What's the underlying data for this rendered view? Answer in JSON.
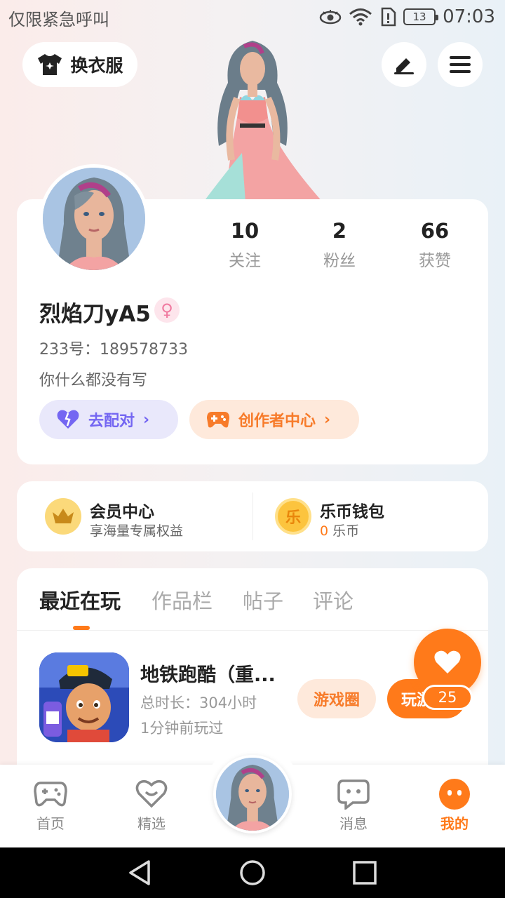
{
  "status_bar": {
    "carrier_text": "仅限紧急呼叫",
    "battery": "13",
    "time": "07:03",
    "icons": [
      "eye-icon",
      "wifi-icon",
      "sim-icon",
      "battery-icon"
    ]
  },
  "header": {
    "outfit_button": "换衣服",
    "edit_icon": "edit-icon",
    "menu_icon": "menu-icon"
  },
  "profile": {
    "stats": [
      {
        "value": "10",
        "label": "关注"
      },
      {
        "value": "2",
        "label": "粉丝"
      },
      {
        "value": "66",
        "label": "获赞"
      }
    ],
    "username": "烈焰刀yA5",
    "gender_symbol": "♀",
    "user_id": "233号：189578733",
    "bio": "你什么都没有写",
    "match_button": "去配对",
    "creator_button": "创作者中心"
  },
  "member": {
    "title": "会员中心",
    "subtitle": "享海量专属权益"
  },
  "wallet": {
    "icon_text": "乐",
    "title": "乐币钱包",
    "amount": "0",
    "unit": "乐币"
  },
  "tabs": [
    "最近在玩",
    "作品栏",
    "帖子",
    "评论"
  ],
  "recent_game": {
    "title": "地铁跑酷（重...",
    "duration": "总时长：304小时",
    "last_played": "1分钟前玩过",
    "circle_button": "游戏圈",
    "play_button": "玩游"
  },
  "favorite": {
    "count": "25"
  },
  "bottom_nav": [
    {
      "label": "首页",
      "icon": "gamepad-icon"
    },
    {
      "label": "精选",
      "icon": "heart-chat-icon"
    },
    {
      "label": "消息",
      "icon": "message-icon"
    },
    {
      "label": "我的",
      "icon": "profile-dots-icon"
    }
  ],
  "colors": {
    "accent": "#ff7a1a",
    "match": "#7466f2",
    "creator": "#f77b2a"
  }
}
